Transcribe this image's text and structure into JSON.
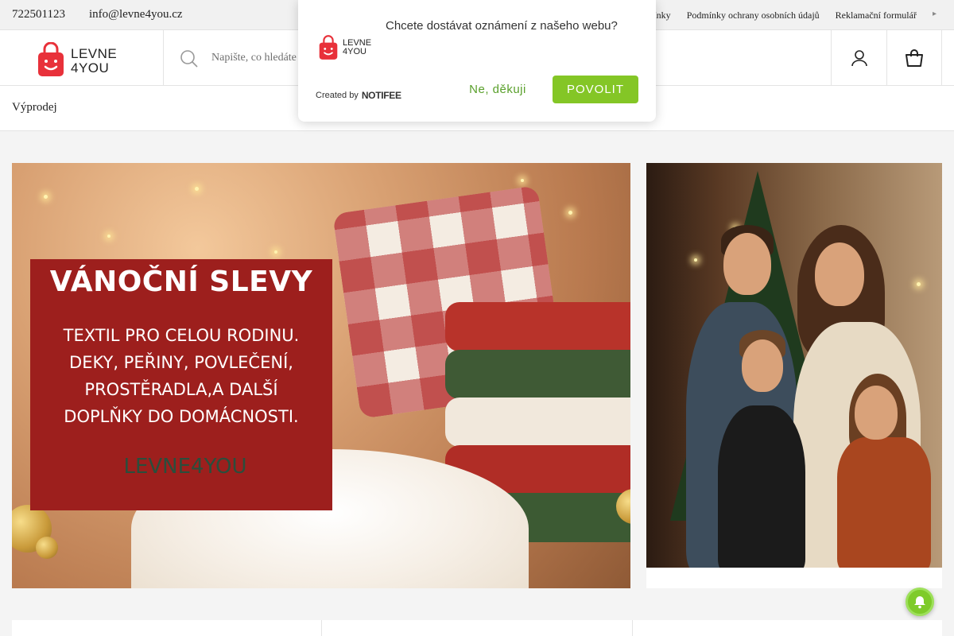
{
  "topbar": {
    "phone": "722501123",
    "email": "info@levne4you.cz",
    "links": [
      "mínky",
      "Podmínky ochrany osobních údajů",
      "Reklamační formulář"
    ],
    "more_icon": "chevron-right-icon"
  },
  "header": {
    "logo_line1": "LEVNE",
    "logo_line2": "4YOU",
    "search_placeholder": "Napište, co hledáte",
    "account_icon": "user-icon",
    "cart_icon": "shopping-bag-icon"
  },
  "nav": {
    "item": "Výprodej"
  },
  "promo": {
    "title": "VÁNOČNÍ SLEVY",
    "lines": [
      "TEXTIL PRO CELOU RODINU.",
      "DEKY, PEŘINY, POVLEČENÍ,",
      "PROSTĚRADLA,A DALŠÍ",
      "DOPLŇKY DO DOMÁCNOSTI."
    ],
    "brand": "LEVNE4YOU"
  },
  "notification": {
    "message": "Chcete dostávat oznámení z našeho webu?",
    "created_by": "Created by",
    "vendor": "NOTIFEE",
    "decline": "Ne, děkuji",
    "allow": "POVOLIT",
    "logo_line1": "LEVNE",
    "logo_line2": "4YOU"
  },
  "colors": {
    "brand_red": "#e8313a",
    "promo_red": "#9d1f1d",
    "accent_green": "#84c626"
  }
}
